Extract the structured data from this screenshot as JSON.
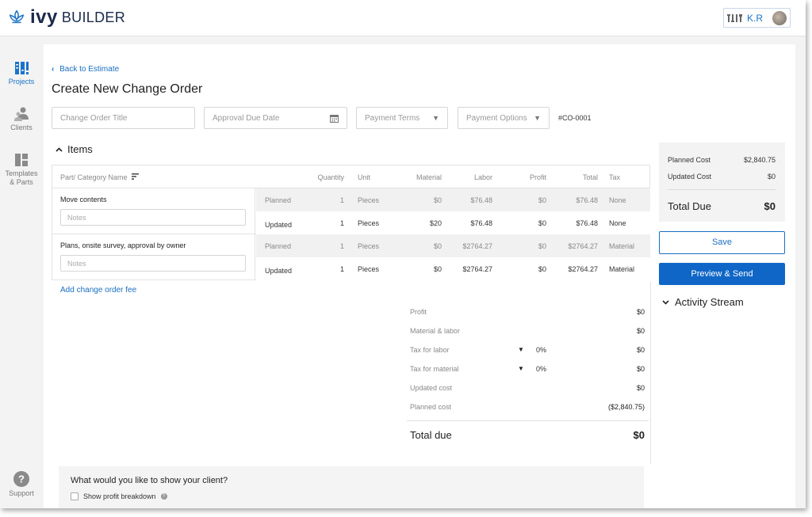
{
  "app": {
    "logo_ivy": "ivy",
    "logo_builder": "BUILDER",
    "user_initials": "K.R",
    "user_tools": "🛠🛠"
  },
  "sidebar": {
    "items": [
      {
        "label": "Projects"
      },
      {
        "label": "Clients"
      },
      {
        "label": "Templates & Parts"
      },
      {
        "label": "Support"
      }
    ]
  },
  "header": {
    "back_label": "Back to Estimate",
    "title": "Create New Change Order"
  },
  "form": {
    "title_placeholder": "Change Order Title",
    "due_date_placeholder": "Approval Due Date",
    "payment_terms_placeholder": "Payment Terms",
    "payment_options_placeholder": "Payment Options",
    "co_number": "#CO-0001"
  },
  "items": {
    "heading": "Items",
    "columns": [
      "Part/ Category Name",
      "Quantity",
      "Unit",
      "Material",
      "Labor",
      "Profit",
      "Total",
      "Tax"
    ],
    "notes_placeholder": "Notes",
    "groups": [
      {
        "name": "Move contents",
        "lines": [
          {
            "type": "Planned",
            "qty": "1",
            "unit": "Pieces",
            "material": "$0",
            "labor": "$76.48",
            "profit": "$0",
            "total": "$76.48",
            "tax": "None"
          },
          {
            "type": "Updated",
            "qty": "1",
            "unit": "Pieces",
            "material": "$20",
            "labor": "$76.48",
            "profit": "$0",
            "total": "$76.48",
            "tax": "None"
          }
        ]
      },
      {
        "name": "Plans, onsite survey, approval by owner",
        "lines": [
          {
            "type": "Planned",
            "qty": "1",
            "unit": "Pieces",
            "material": "$0",
            "labor": "$2764.27",
            "profit": "$0",
            "total": "$2764.27",
            "tax": "Material"
          },
          {
            "type": "Updated",
            "qty": "1",
            "unit": "Pieces",
            "material": "$0",
            "labor": "$2764.27",
            "profit": "$0",
            "total": "$2764.27",
            "tax": "Material"
          }
        ]
      }
    ],
    "add_fee_label": "Add change order fee"
  },
  "summary": {
    "rows": [
      {
        "label": "Profit",
        "pct": "",
        "value": "$0"
      },
      {
        "label": "Material & labor",
        "pct": "",
        "value": "$0"
      },
      {
        "label": "Tax for labor",
        "pct": "0%",
        "value": "$0"
      },
      {
        "label": "Tax for material",
        "pct": "0%",
        "value": "$0"
      },
      {
        "label": "Updated cost",
        "pct": "",
        "value": "$0"
      },
      {
        "label": "Planned cost",
        "pct": "",
        "value": "($2,840.75)"
      }
    ],
    "total_label": "Total due",
    "total_value": "$0"
  },
  "client_view": {
    "title": "What would you like to show your client?",
    "profit_breakdown_label": "Show profit breakdown"
  },
  "cost_panel": {
    "planned_label": "Planned Cost",
    "planned_value": "$2,840.75",
    "updated_label": "Updated Cost",
    "updated_value": "$0",
    "total_label": "Total Due",
    "total_value": "$0"
  },
  "actions": {
    "save_label": "Save",
    "send_label": "Preview & Send"
  },
  "activity": {
    "label": "Activity Stream"
  },
  "colors": {
    "accent": "#0f66c6",
    "link": "#1a6fc2",
    "brand_navy": "#1b2a4a"
  }
}
